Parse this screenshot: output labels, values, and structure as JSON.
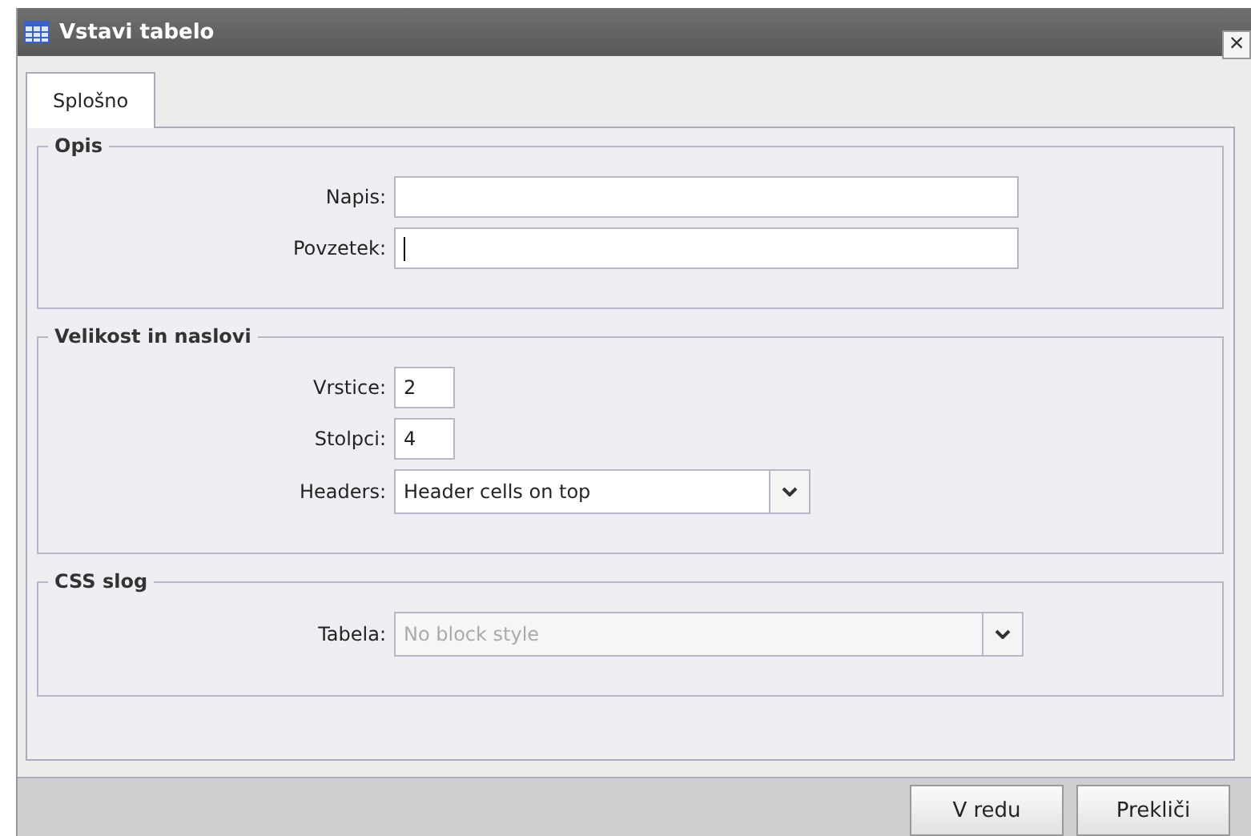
{
  "window": {
    "title": "Vstavi tabelo",
    "close": "×"
  },
  "tabs": [
    {
      "label": "Splošno",
      "selected": true
    }
  ],
  "fieldsets": [
    {
      "legend": "Opis",
      "fields": [
        {
          "kind": "text",
          "label": "Napis:"
        },
        {
          "kind": "text",
          "label": "Povzetek:",
          "focused": true
        }
      ]
    },
    {
      "legend": "Velikost in naslovi",
      "fields": [
        {
          "kind": "number",
          "label": "Vrstice:",
          "value": "2"
        },
        {
          "kind": "number",
          "label": "Stolpci:",
          "value": "4"
        },
        {
          "kind": "select",
          "label": "Headers:",
          "value": "Header cells on top",
          "disabled": false
        }
      ]
    },
    {
      "legend": "CSS slog",
      "fields": [
        {
          "kind": "wide-select",
          "label": "Tabela:",
          "value": "No block style",
          "disabled": true
        }
      ]
    }
  ],
  "buttons": [
    "V redu",
    "Prekliči"
  ]
}
